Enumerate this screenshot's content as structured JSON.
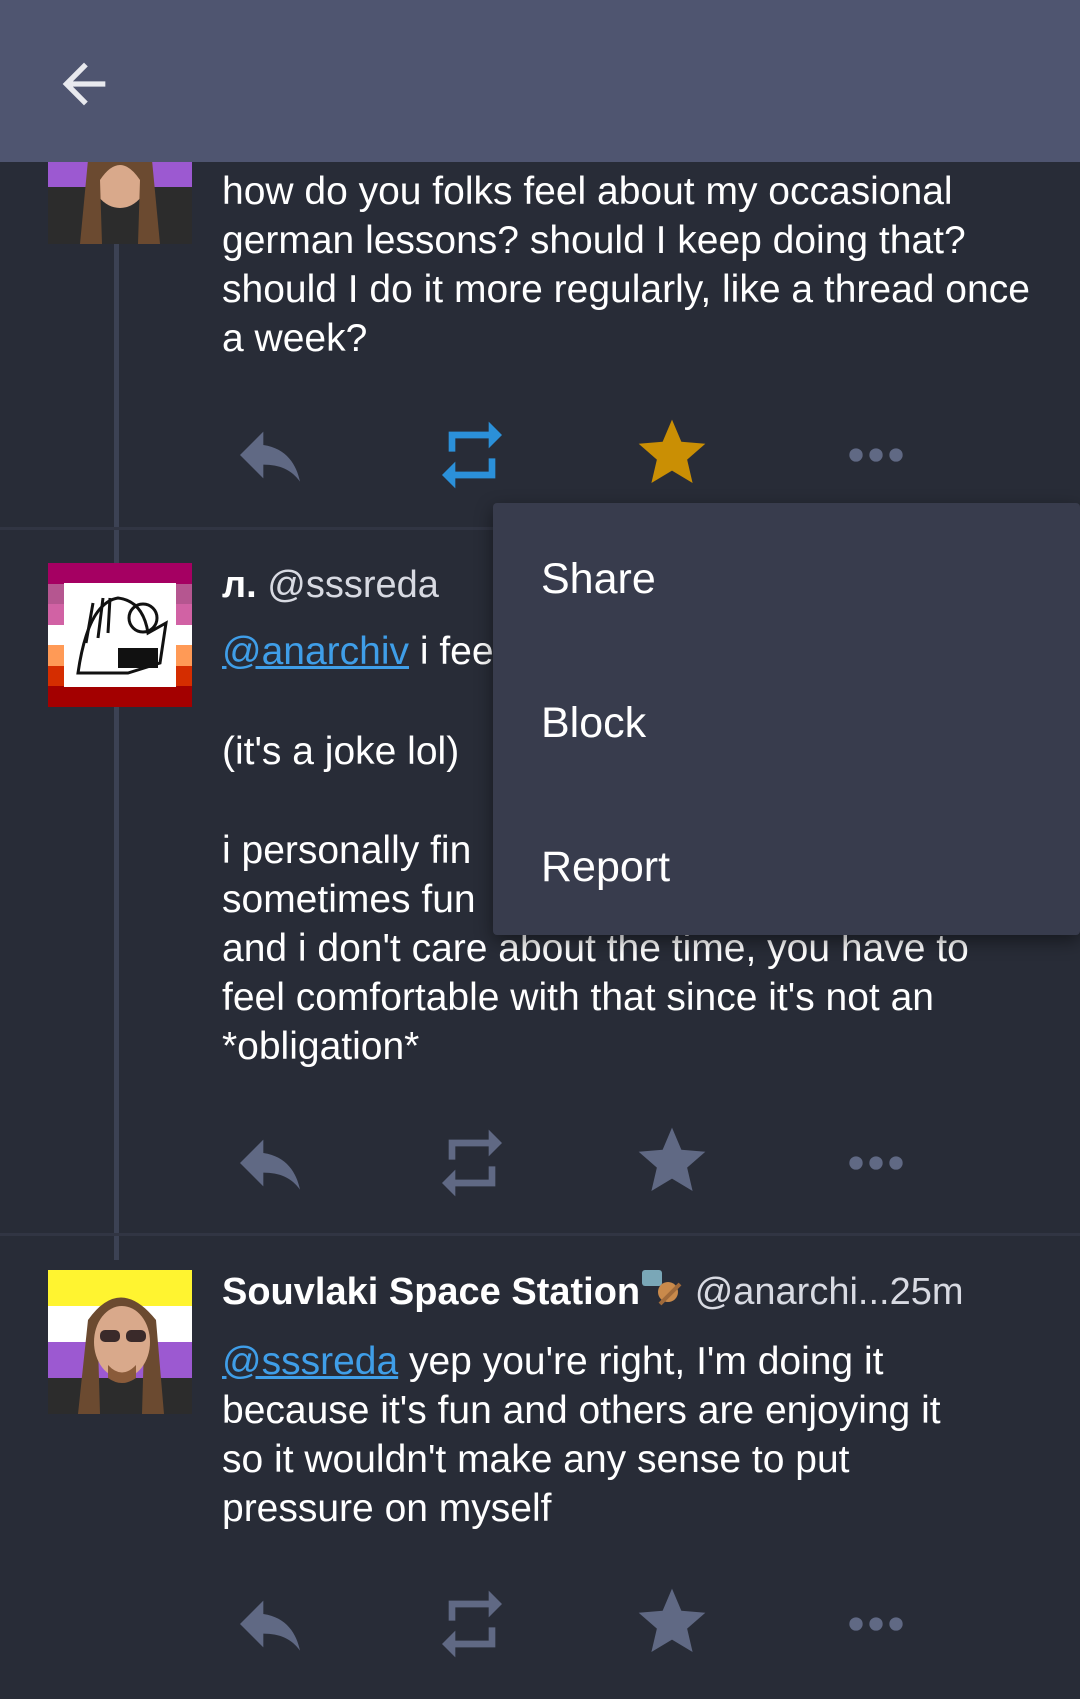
{
  "menu": {
    "items": [
      "Share",
      "Block",
      "Report"
    ]
  },
  "posts": [
    {
      "text": "how do you folks feel about my occasional german lessons? should I keep doing that? should I do it more regularly, like a thread once a week?",
      "reblogged": true,
      "favourited": true
    },
    {
      "display_name": "л.",
      "handle": "@sssreda",
      "mention": "@anarchiv",
      "text_visible_1": " i fee",
      "text_visible_2": "(it's a joke lol)",
      "text_visible_3": "i personally fin",
      "text_visible_4": "sometimes fun",
      "text_visible_5": "and i don't care about the time, you have to feel comfortable with that since it's not an *obligation*",
      "reblogged": false,
      "favourited": false
    },
    {
      "display_name": "Souvlaki Space Station",
      "handle": "@anarchi...",
      "time": "25m",
      "mention": "@sssreda",
      "text": " yep you're right, I'm doing it because it's fun and others are enjoying it so it wouldn't make any sense to put pressure on myself",
      "reblogged": false,
      "favourited": false
    }
  ],
  "colors": {
    "appbar": "#4f5570",
    "background": "#282c37",
    "icon_inactive": "#606984",
    "boost_active": "#2b90d9",
    "fav_active": "#ca8f04",
    "link": "#3f9ee8",
    "menu_bg": "#383c4d"
  },
  "icons": {
    "back": "arrow-left-icon",
    "reply": "reply-icon",
    "boost": "retweet-icon",
    "favourite": "star-icon",
    "more": "ellipsis-icon"
  }
}
